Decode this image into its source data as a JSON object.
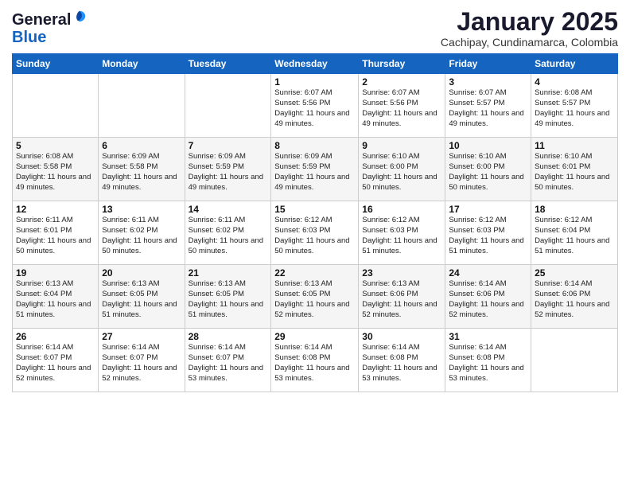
{
  "logo": {
    "general": "General",
    "blue": "Blue"
  },
  "header": {
    "month": "January 2025",
    "location": "Cachipay, Cundinamarca, Colombia"
  },
  "weekdays": [
    "Sunday",
    "Monday",
    "Tuesday",
    "Wednesday",
    "Thursday",
    "Friday",
    "Saturday"
  ],
  "weeks": [
    [
      {
        "day": "",
        "info": ""
      },
      {
        "day": "",
        "info": ""
      },
      {
        "day": "",
        "info": ""
      },
      {
        "day": "1",
        "info": "Sunrise: 6:07 AM\nSunset: 5:56 PM\nDaylight: 11 hours\nand 49 minutes."
      },
      {
        "day": "2",
        "info": "Sunrise: 6:07 AM\nSunset: 5:56 PM\nDaylight: 11 hours\nand 49 minutes."
      },
      {
        "day": "3",
        "info": "Sunrise: 6:07 AM\nSunset: 5:57 PM\nDaylight: 11 hours\nand 49 minutes."
      },
      {
        "day": "4",
        "info": "Sunrise: 6:08 AM\nSunset: 5:57 PM\nDaylight: 11 hours\nand 49 minutes."
      }
    ],
    [
      {
        "day": "5",
        "info": "Sunrise: 6:08 AM\nSunset: 5:58 PM\nDaylight: 11 hours\nand 49 minutes."
      },
      {
        "day": "6",
        "info": "Sunrise: 6:09 AM\nSunset: 5:58 PM\nDaylight: 11 hours\nand 49 minutes."
      },
      {
        "day": "7",
        "info": "Sunrise: 6:09 AM\nSunset: 5:59 PM\nDaylight: 11 hours\nand 49 minutes."
      },
      {
        "day": "8",
        "info": "Sunrise: 6:09 AM\nSunset: 5:59 PM\nDaylight: 11 hours\nand 49 minutes."
      },
      {
        "day": "9",
        "info": "Sunrise: 6:10 AM\nSunset: 6:00 PM\nDaylight: 11 hours\nand 50 minutes."
      },
      {
        "day": "10",
        "info": "Sunrise: 6:10 AM\nSunset: 6:00 PM\nDaylight: 11 hours\nand 50 minutes."
      },
      {
        "day": "11",
        "info": "Sunrise: 6:10 AM\nSunset: 6:01 PM\nDaylight: 11 hours\nand 50 minutes."
      }
    ],
    [
      {
        "day": "12",
        "info": "Sunrise: 6:11 AM\nSunset: 6:01 PM\nDaylight: 11 hours\nand 50 minutes."
      },
      {
        "day": "13",
        "info": "Sunrise: 6:11 AM\nSunset: 6:02 PM\nDaylight: 11 hours\nand 50 minutes."
      },
      {
        "day": "14",
        "info": "Sunrise: 6:11 AM\nSunset: 6:02 PM\nDaylight: 11 hours\nand 50 minutes."
      },
      {
        "day": "15",
        "info": "Sunrise: 6:12 AM\nSunset: 6:03 PM\nDaylight: 11 hours\nand 50 minutes."
      },
      {
        "day": "16",
        "info": "Sunrise: 6:12 AM\nSunset: 6:03 PM\nDaylight: 11 hours\nand 51 minutes."
      },
      {
        "day": "17",
        "info": "Sunrise: 6:12 AM\nSunset: 6:03 PM\nDaylight: 11 hours\nand 51 minutes."
      },
      {
        "day": "18",
        "info": "Sunrise: 6:12 AM\nSunset: 6:04 PM\nDaylight: 11 hours\nand 51 minutes."
      }
    ],
    [
      {
        "day": "19",
        "info": "Sunrise: 6:13 AM\nSunset: 6:04 PM\nDaylight: 11 hours\nand 51 minutes."
      },
      {
        "day": "20",
        "info": "Sunrise: 6:13 AM\nSunset: 6:05 PM\nDaylight: 11 hours\nand 51 minutes."
      },
      {
        "day": "21",
        "info": "Sunrise: 6:13 AM\nSunset: 6:05 PM\nDaylight: 11 hours\nand 51 minutes."
      },
      {
        "day": "22",
        "info": "Sunrise: 6:13 AM\nSunset: 6:05 PM\nDaylight: 11 hours\nand 52 minutes."
      },
      {
        "day": "23",
        "info": "Sunrise: 6:13 AM\nSunset: 6:06 PM\nDaylight: 11 hours\nand 52 minutes."
      },
      {
        "day": "24",
        "info": "Sunrise: 6:14 AM\nSunset: 6:06 PM\nDaylight: 11 hours\nand 52 minutes."
      },
      {
        "day": "25",
        "info": "Sunrise: 6:14 AM\nSunset: 6:06 PM\nDaylight: 11 hours\nand 52 minutes."
      }
    ],
    [
      {
        "day": "26",
        "info": "Sunrise: 6:14 AM\nSunset: 6:07 PM\nDaylight: 11 hours\nand 52 minutes."
      },
      {
        "day": "27",
        "info": "Sunrise: 6:14 AM\nSunset: 6:07 PM\nDaylight: 11 hours\nand 52 minutes."
      },
      {
        "day": "28",
        "info": "Sunrise: 6:14 AM\nSunset: 6:07 PM\nDaylight: 11 hours\nand 53 minutes."
      },
      {
        "day": "29",
        "info": "Sunrise: 6:14 AM\nSunset: 6:08 PM\nDaylight: 11 hours\nand 53 minutes."
      },
      {
        "day": "30",
        "info": "Sunrise: 6:14 AM\nSunset: 6:08 PM\nDaylight: 11 hours\nand 53 minutes."
      },
      {
        "day": "31",
        "info": "Sunrise: 6:14 AM\nSunset: 6:08 PM\nDaylight: 11 hours\nand 53 minutes."
      },
      {
        "day": "",
        "info": ""
      }
    ]
  ]
}
